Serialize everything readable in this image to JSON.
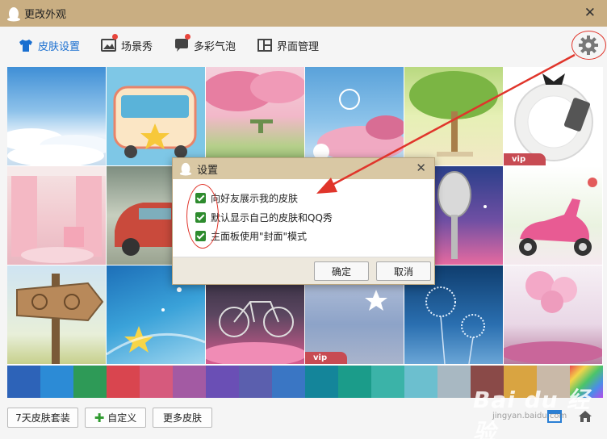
{
  "window": {
    "title": "更改外观"
  },
  "tabs": [
    {
      "label": "皮肤设置",
      "icon": "shirt-icon",
      "active": true
    },
    {
      "label": "场景秀",
      "icon": "picture-icon",
      "badge": true
    },
    {
      "label": "多彩气泡",
      "icon": "bubble-icon",
      "badge": true
    },
    {
      "label": "界面管理",
      "icon": "layout-icon"
    }
  ],
  "tiles": [
    {
      "name": "sky-clouds",
      "vip": false
    },
    {
      "name": "cartoon-bus",
      "vip": false
    },
    {
      "name": "pink-tree",
      "vip": false
    },
    {
      "name": "blue-blossom",
      "vip": false
    },
    {
      "name": "green-tree",
      "vip": false
    },
    {
      "name": "plate-fork",
      "vip": true
    },
    {
      "name": "pink-room",
      "vip": false
    },
    {
      "name": "red-car",
      "vip": false
    },
    {
      "name": "hidden-1",
      "vip": false
    },
    {
      "name": "hidden-2",
      "vip": false
    },
    {
      "name": "microphone",
      "vip": false
    },
    {
      "name": "scooter",
      "vip": false
    },
    {
      "name": "wood-sign",
      "vip": false
    },
    {
      "name": "stars-blue",
      "vip": false
    },
    {
      "name": "bicycle",
      "vip": false
    },
    {
      "name": "moon",
      "vip": true
    },
    {
      "name": "dandelion",
      "vip": false
    },
    {
      "name": "balloons",
      "vip": false
    }
  ],
  "vip_label": "vip",
  "swatches": [
    "#2d63b8",
    "#2c8bd6",
    "#2e9a57",
    "#d9454f",
    "#d65a7d",
    "#a35aa3",
    "#6a4fb5",
    "#5b5fae",
    "#3a76c4",
    "#14859a",
    "#1b9c8a",
    "#3bb3a8",
    "#6cbfcf",
    "#a8b8c2",
    "#8a4a48",
    "#d9a441",
    "#c9b9a8",
    "#d9d0e0"
  ],
  "bottom": {
    "btn_7day": "7天皮肤套装",
    "btn_custom": "自定义",
    "btn_more": "更多皮肤"
  },
  "dialog": {
    "title": "设置",
    "options": [
      "向好友展示我的皮肤",
      "默认显示自己的皮肤和QQ秀",
      "主面板使用\"封面\"模式"
    ],
    "ok": "确定",
    "cancel": "取消"
  },
  "watermark": {
    "text": "Bai du 经验",
    "sub": "jingyan.baidu.com"
  },
  "colors": {
    "titlebar": "#c9ae82",
    "accent": "#1a6fd0",
    "annotation": "#e0352b"
  }
}
